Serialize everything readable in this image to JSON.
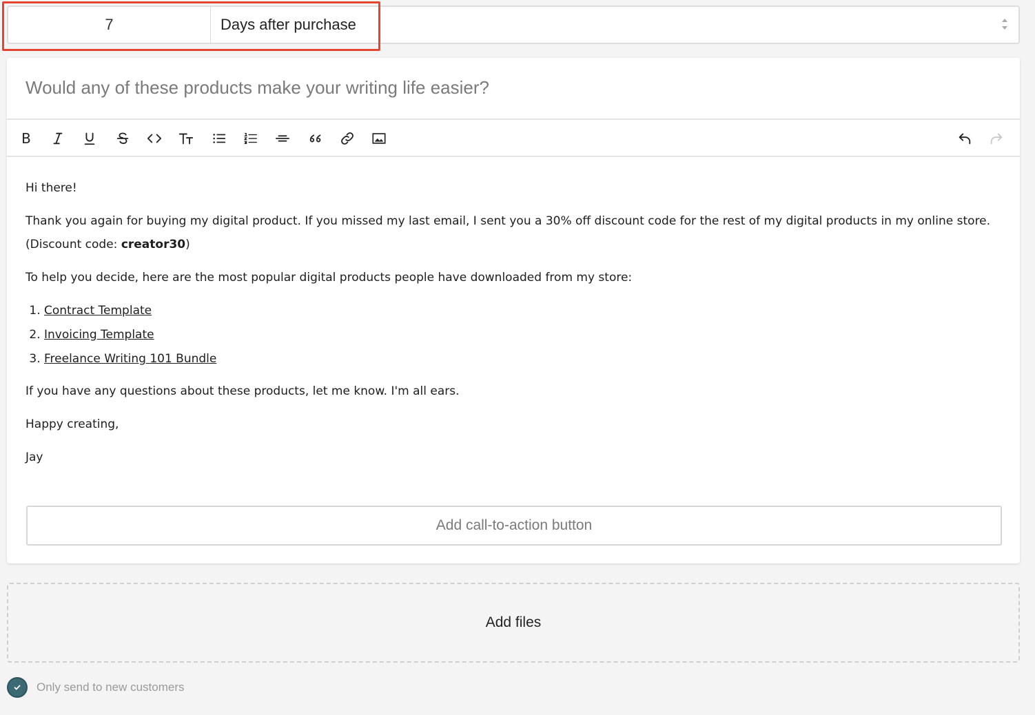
{
  "delay": {
    "number_value": "7",
    "unit_label": "Days after purchase"
  },
  "email": {
    "subject": "Would any of these products make your writing life easier?",
    "greeting": "Hi there!",
    "paragraph1_text": "Thank you again for buying my digital product. If you missed my last email, I sent you a 30% off discount code for the rest of my digital products in my online store. (Discount code: ",
    "discount_code": "creator30",
    "paragraph1_end": ")",
    "paragraph2": "To help you decide, here are the most popular digital products people have downloaded from my store:",
    "products": [
      "Contract Template ",
      "Invoicing Template ",
      "Freelance Writing 101 Bundle"
    ],
    "paragraph3": "If you have any questions about these products, let me know. I'm all ears.",
    "signoff": "Happy creating,",
    "signature": "Jay"
  },
  "toolbar": {
    "bold_label": "B",
    "text_size_label": "TT",
    "icons": [
      "bold",
      "italic-icon",
      "underline-icon",
      "strikethrough-icon",
      "code-icon",
      "text-size-icon",
      "bullet-list-icon",
      "numbered-list-icon",
      "horizontal-rule-icon",
      "quote-icon",
      "link-icon",
      "image-icon",
      "undo-icon",
      "redo-icon"
    ]
  },
  "cta": {
    "label": "Add call-to-action button"
  },
  "files": {
    "label": "Add files"
  },
  "options": {
    "new_customers_label": "Only send to new customers",
    "new_customers_checked": true
  },
  "colors": {
    "highlight": "#e5452f",
    "checkbox": "#3b6a74"
  }
}
